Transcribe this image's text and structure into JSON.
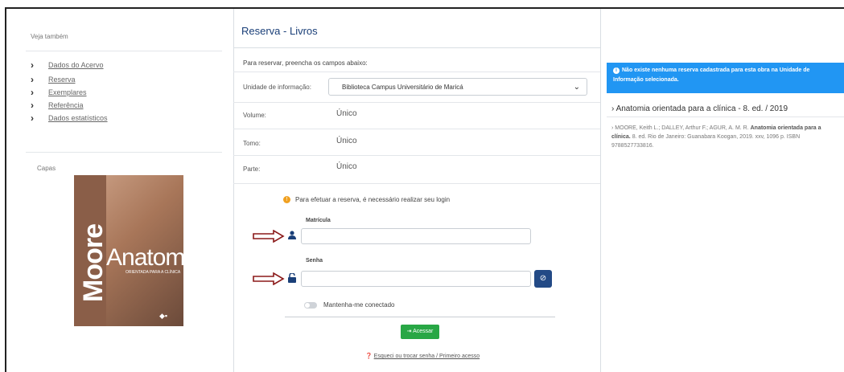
{
  "left": {
    "see_also_title": "Veja também",
    "links": [
      "Dados do Acervo",
      "Reserva",
      "Exemplares",
      "Referência",
      "Dados estatísticos"
    ],
    "covers_title": "Capas",
    "cover": {
      "author": "Moore",
      "title": "Anatomia",
      "subtitle": "ORIENTADA PARA A CLÍNICA"
    }
  },
  "main": {
    "title": "Reserva - Livros",
    "instruction": "Para reservar, preencha os campos abaixo:",
    "unit_label": "Unidade de informação:",
    "unit_value": "Biblioteca Campus Universitário de Maricá",
    "volume_label": "Volume:",
    "volume_value": "Único",
    "tomo_label": "Tomo:",
    "tomo_value": "Único",
    "parte_label": "Parte:",
    "parte_value": "Único",
    "login_alert": "Para efetuar a reserva, é necessário realizar seu login",
    "matricula_label": "Matrícula",
    "senha_label": "Senha",
    "keep_connected": "Mantenha-me conectado",
    "login_button": "Acessar",
    "forgot": "Esqueci ou trocar senha / Primeiro acesso"
  },
  "right": {
    "info_line1": "Não existe nenhuma reserva cadastrada para esta obra na Unidade de",
    "info_line2": "Informação selecionada.",
    "book_title": "Anatomia orientada para a clínica - 8. ed. / 2019",
    "ref_authors": "MOORE, Keith L.; DALLEY, Arthur F.; AGUR, A. M. R.",
    "ref_title": "Anatomia orientada para a clínica.",
    "ref_rest": "8. ed. Rio de Janeiro: Guanabara Koogan, 2019. xxv, 1096 p. ISBN 9788527733816."
  },
  "colors": {
    "title_blue": "#1a3f78",
    "info_blue": "#2196f3",
    "login_green": "#28a745",
    "arrow_red": "#8b1a1a"
  },
  "icons": [
    "chevron-right-icon",
    "chevron-down-icon",
    "user-icon",
    "lock-open-icon",
    "eye-slash-icon",
    "sign-in-icon",
    "question-icon",
    "info-icon",
    "warning-icon"
  ]
}
